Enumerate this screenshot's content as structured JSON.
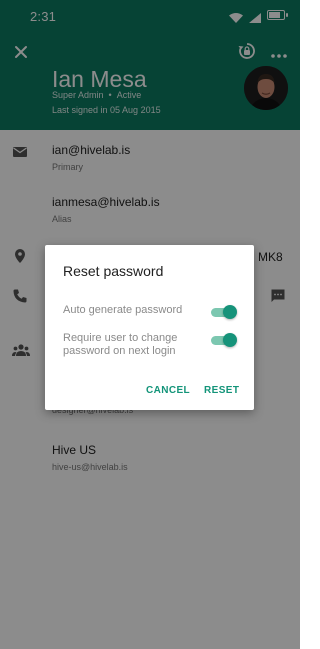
{
  "status_bar": {
    "time": "2:31"
  },
  "profile": {
    "name": "Ian Mesa",
    "role": "Super Admin",
    "separator": "•",
    "state": "Active",
    "last_signed": "Last signed in 05 Aug 2015"
  },
  "emails": [
    {
      "address": "ian@hivelab.is",
      "type": "Primary"
    },
    {
      "address": "ianmesa@hivelab.is",
      "type": "Alias"
    }
  ],
  "location_suffix": "MK8",
  "groups_partial": "designer@hivelab.is",
  "group": {
    "name": "Hive US",
    "email": "hive-us@hivelab.is"
  },
  "dialog": {
    "title": "Reset password",
    "options": [
      {
        "label": "Auto generate password",
        "enabled": true
      },
      {
        "label": "Require user to change password on next login",
        "enabled": true
      }
    ],
    "cancel_label": "CANCEL",
    "reset_label": "RESET"
  },
  "colors": {
    "header": "#0b7a62",
    "accent": "#139479"
  }
}
